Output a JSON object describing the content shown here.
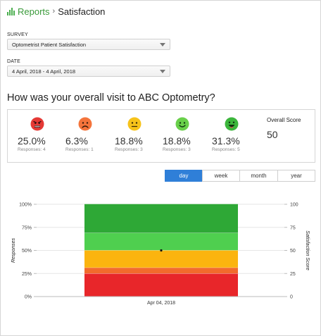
{
  "header": {
    "section": "Reports",
    "separator": "›",
    "current": "Satisfaction"
  },
  "survey": {
    "label": "SURVEY",
    "value": "Optometrist Patient Satisfaction"
  },
  "date": {
    "label": "DATE",
    "value": "4 April, 2018 - 4 April, 2018"
  },
  "question": "How was your overall visit to ABC Optometry?",
  "scores": [
    {
      "pct": "25.0%",
      "responses": "Responses: 4",
      "color": "#e53935",
      "mood": "angry"
    },
    {
      "pct": "6.3%",
      "responses": "Responses: 1",
      "color": "#f4743b",
      "mood": "sad"
    },
    {
      "pct": "18.8%",
      "responses": "Responses: 3",
      "color": "#f7c31a",
      "mood": "neutral"
    },
    {
      "pct": "18.8%",
      "responses": "Responses: 3",
      "color": "#69d04a",
      "mood": "smile"
    },
    {
      "pct": "31.3%",
      "responses": "Responses: 5",
      "color": "#3cb63c",
      "mood": "happy"
    }
  ],
  "overall": {
    "label": "Overall Score",
    "value": "50"
  },
  "periods": [
    {
      "label": "day",
      "active": true
    },
    {
      "label": "week",
      "active": false
    },
    {
      "label": "month",
      "active": false
    },
    {
      "label": "year",
      "active": false
    }
  ],
  "chart_data": {
    "type": "bar",
    "stacked": true,
    "categories": [
      "Apr 04, 2018"
    ],
    "series": [
      {
        "values": [
          25.0
        ],
        "color": "#e8262a"
      },
      {
        "values": [
          6.3
        ],
        "color": "#f26b2c"
      },
      {
        "values": [
          18.8
        ],
        "color": "#fbb40f"
      },
      {
        "values": [
          18.8
        ],
        "color": "#4fcf4f"
      },
      {
        "values": [
          31.3
        ],
        "color": "#2ea836"
      }
    ],
    "overlay_line": {
      "name": "Satisfaction Score",
      "values": [
        50
      ]
    },
    "ylabel": "Responses",
    "y2label": "Satisfaction Score",
    "ylim": [
      0,
      100
    ],
    "y_ticks": [
      "0%",
      "25%",
      "50%",
      "75%",
      "100%"
    ],
    "y2_ticks": [
      "0",
      "25",
      "50",
      "75",
      "100"
    ],
    "grid": true
  }
}
